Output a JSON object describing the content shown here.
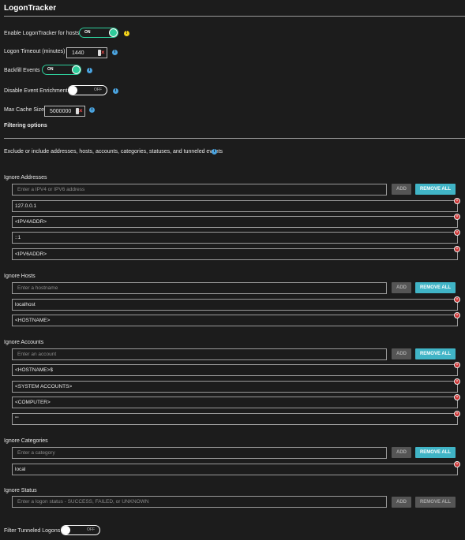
{
  "title": "LogonTracker",
  "settings": {
    "enable_label": "Enable LogonTracker for hosts",
    "enable_toggle": "ON",
    "timeout_label": "Logon Timeout (minutes)",
    "timeout_value": "1440",
    "backfill_label": "Backfill Events",
    "backfill_toggle": "ON",
    "disable_enrichment_label": "Disable Event Enrichment",
    "disable_enrichment_toggle": "OFF",
    "cache_label": "Max Cache Size",
    "cache_value": "5000000"
  },
  "filtering": {
    "heading": "Filtering options",
    "description": "Exclude or include addresses, hosts, accounts, categories, statuses, and tunneled events"
  },
  "buttons": {
    "add": "ADD",
    "remove_all": "REMOVE ALL"
  },
  "ignore_addresses": {
    "label": "Ignore Addresses",
    "placeholder": "Enter a IPV4 or IPV6 address",
    "items": [
      "127.0.0.1",
      "<IPV4ADDR>",
      "::1",
      "<IPV6ADDR>"
    ]
  },
  "ignore_hosts": {
    "label": "Ignore Hosts",
    "placeholder": "Enter a hostname",
    "items": [
      "localhost",
      "<HOSTNAME>"
    ]
  },
  "ignore_accounts": {
    "label": "Ignore Accounts",
    "placeholder": "Enter an account",
    "items": [
      "<HOSTNAME>$",
      "<SYSTEM ACCOUNTS>",
      "<COMPUTER>",
      "\"\""
    ]
  },
  "ignore_categories": {
    "label": "Ignore Categories",
    "placeholder": "Enter a category",
    "items": [
      "local"
    ]
  },
  "ignore_status": {
    "label": "Ignore Status",
    "placeholder": "Enter a logon status - SUCCESS, FAILED, or UNKNOWN"
  },
  "tunneled": {
    "label": "Filter Tunneled Logons",
    "toggle": "OFF"
  },
  "colors": {
    "accent_teal": "#40b4c6",
    "toggle_on": "#2ecc9a",
    "info_blue": "#4aa3df",
    "warning_yellow": "#f2d21b",
    "remove_red": "#cc3333"
  }
}
